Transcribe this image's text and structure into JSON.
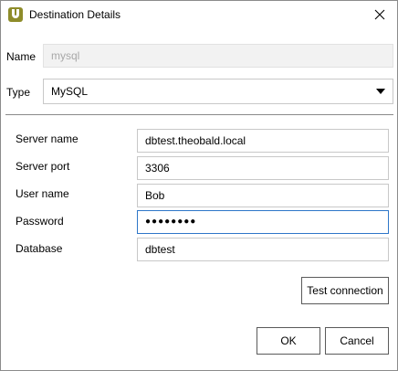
{
  "window": {
    "title": "Destination Details",
    "app_icon": "theobald-u-icon",
    "close_icon": "close-icon"
  },
  "name_row": {
    "label": "Name",
    "value": "mysql"
  },
  "type_row": {
    "label": "Type",
    "value": "MySQL",
    "dropdown_icon": "chevron-down-icon"
  },
  "connection": {
    "server_name": {
      "label": "Server name",
      "value": "dbtest.theobald.local"
    },
    "server_port": {
      "label": "Server port",
      "value": "3306"
    },
    "user_name": {
      "label": "User name",
      "value": "Bob"
    },
    "password": {
      "label": "Password",
      "value": "●●●●●●●●"
    },
    "database": {
      "label": "Database",
      "value": "dbtest"
    }
  },
  "buttons": {
    "test_connection": "Test connection",
    "ok": "OK",
    "cancel": "Cancel"
  },
  "colors": {
    "accent_focus": "#2e76c8",
    "app_icon": "#8e8c2a"
  }
}
